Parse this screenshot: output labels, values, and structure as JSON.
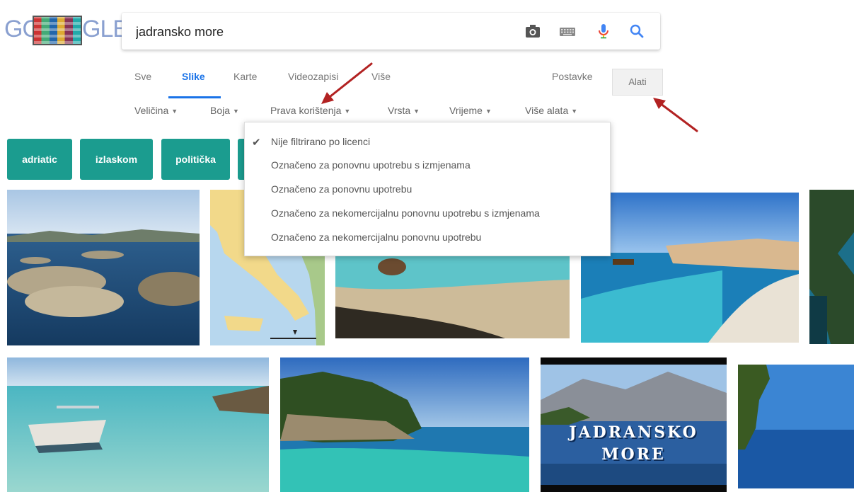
{
  "logo": {
    "left_text": "GO",
    "right_text": "GLE"
  },
  "search": {
    "query": "jadransko more"
  },
  "icons": {
    "camera": "camera-icon",
    "keyboard": "keyboard-icon",
    "mic": "microphone-icon",
    "search": "search-icon"
  },
  "tabs": [
    {
      "label": "Sve"
    },
    {
      "label": "Slike"
    },
    {
      "label": "Karte"
    },
    {
      "label": "Videozapisi"
    },
    {
      "label": "Više"
    }
  ],
  "header_right": {
    "settings_label": "Postavke",
    "tools_label": "Alati"
  },
  "filters": [
    {
      "label": "Veličina"
    },
    {
      "label": "Boja"
    },
    {
      "label": "Prava korištenja"
    },
    {
      "label": "Vrsta"
    },
    {
      "label": "Vrijeme"
    },
    {
      "label": "Više alata"
    }
  ],
  "chips": [
    {
      "label": "adriatic"
    },
    {
      "label": "izlaskom"
    },
    {
      "label": "politička"
    }
  ],
  "dropdown": {
    "items": [
      {
        "label": "Nije filtrirano po licenci",
        "checked": true
      },
      {
        "label": "Označeno za ponovnu upotrebu s izmjenama"
      },
      {
        "label": "Označeno za ponovnu upotrebu"
      },
      {
        "label": "Označeno za nekomercijalnu ponovnu upotrebu s izmjenama"
      },
      {
        "label": "Označeno za nekomercijalnu ponovnu upotrebu"
      }
    ]
  },
  "image_texts": {
    "jadransko_line1": "JADRANSKO",
    "jadransko_line2": "MORE"
  },
  "colors": {
    "active_tab": "#1a73e8",
    "chip_bg": "#1b9c8f",
    "annotation_arrow": "#b22222"
  }
}
